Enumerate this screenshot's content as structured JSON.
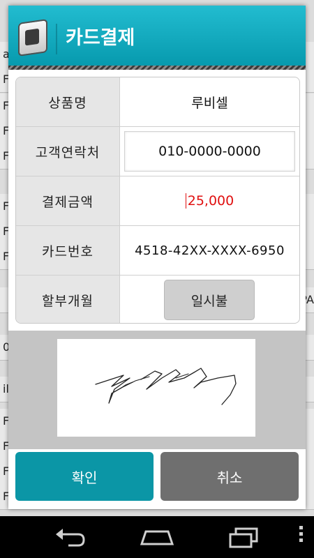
{
  "dialog": {
    "title": "카드결제"
  },
  "fields": {
    "product_name_label": "상품명",
    "product_name_value": "루비셀",
    "contact_label": "고객연락처",
    "contact_value": "010-0000-0000",
    "amount_label": "결제금액",
    "amount_value": "25,000",
    "card_number_label": "카드번호",
    "card_number_value": "4518-42XX-XXXX-6950",
    "installment_label": "할부개월",
    "installment_value": "일시불"
  },
  "buttons": {
    "confirm": "확인",
    "cancel": "취소"
  },
  "background": {
    "left_letters": [
      "ap",
      "F",
      "F",
      "F",
      "F",
      "F",
      "F",
      "F",
      "0",
      "ile",
      "F",
      "F",
      "F",
      "F",
      "F"
    ],
    "right_text": "PA"
  },
  "colors": {
    "header": "#0aa5b8",
    "confirm_button": "#0b96a6",
    "cancel_button": "#6f6f6f",
    "amount_text": "#e01010"
  },
  "icons": {
    "app": "wallet-card-icon",
    "nav": [
      "back-icon",
      "home-icon",
      "recent-apps-icon",
      "overflow-menu-icon"
    ]
  }
}
